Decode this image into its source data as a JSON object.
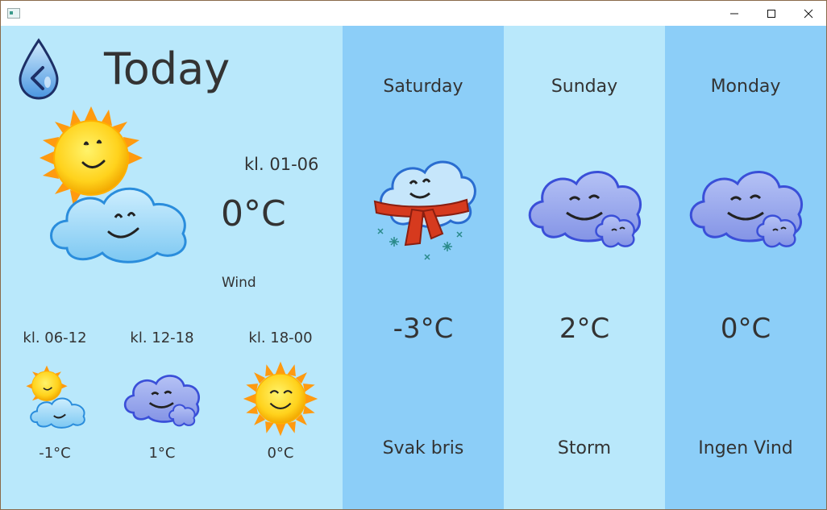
{
  "today": {
    "back_icon": "water-drop-back-icon",
    "title": "Today",
    "main_period": "kl. 01-06",
    "main_temp": "0°C",
    "main_wind": "Wind",
    "main_icon": "sun-behind-cloud-icon",
    "periods": [
      {
        "label": "kl. 06-12",
        "temp": "-1°C",
        "icon": "sun-behind-cloud-icon"
      },
      {
        "label": "kl. 12-18",
        "temp": "1°C",
        "icon": "cloudy-icon"
      },
      {
        "label": "kl. 18-00",
        "temp": "0°C",
        "icon": "sun-icon"
      }
    ]
  },
  "forecast": [
    {
      "day": "Saturday",
      "temp": "-3°C",
      "wind": "Svak bris",
      "icon": "snow-cloud-icon"
    },
    {
      "day": "Sunday",
      "temp": "2°C",
      "wind": "Storm",
      "icon": "cloudy-icon"
    },
    {
      "day": "Monday",
      "temp": "0°C",
      "wind": "Ingen Vind",
      "icon": "cloudy-icon"
    }
  ],
  "colors": {
    "today_bg": "#b9e8fb",
    "dark_col": "#8ccef8",
    "light_col": "#b9e8fb"
  }
}
